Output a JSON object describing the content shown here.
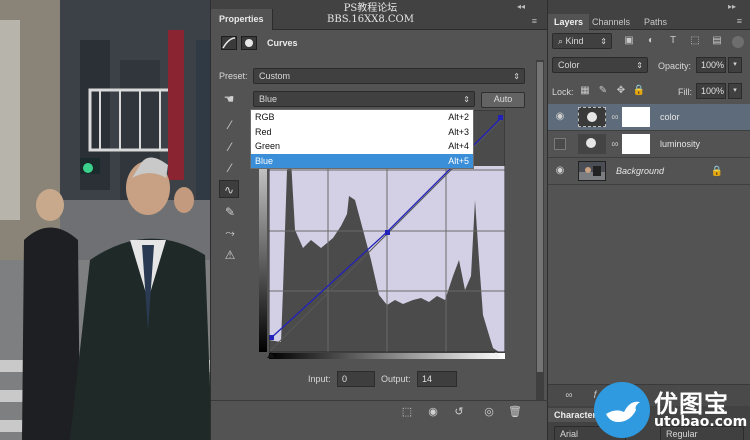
{
  "properties": {
    "tab_label": "Properties",
    "watermark_line1": "PS教程论坛",
    "watermark_line2": "BBS.16XX8.COM",
    "adjustment_name": "Curves",
    "preset_label": "Preset:",
    "preset_value": "Custom",
    "channel_value": "Blue",
    "auto_label": "Auto",
    "channel_menu": [
      {
        "label": "RGB",
        "shortcut": "Alt+2"
      },
      {
        "label": "Red",
        "shortcut": "Alt+3"
      },
      {
        "label": "Green",
        "shortcut": "Alt+4"
      },
      {
        "label": "Blue",
        "shortcut": "Alt+5"
      }
    ],
    "input_label": "Input:",
    "input_value": "0",
    "output_label": "Output:",
    "output_value": "14"
  },
  "layers": {
    "tabs": [
      "Layers",
      "Channels",
      "Paths"
    ],
    "kind_value": "Kind",
    "blend_mode": "Color",
    "opacity_label": "Opacity:",
    "opacity_value": "100%",
    "lock_label": "Lock:",
    "fill_label": "Fill:",
    "fill_value": "100%",
    "items": [
      {
        "name": "color"
      },
      {
        "name": "luminosity"
      },
      {
        "name": "Background"
      }
    ],
    "character_tab": "Character",
    "font_value": "Arial",
    "style_value": "Regular"
  },
  "watermark_bottom": {
    "brand": "优图宝",
    "url": "utobao.com"
  },
  "colors": {
    "menu_selected": "#3a8fd8",
    "layer_selected": "#5e6b7a",
    "curve_line": "#2222bb"
  }
}
